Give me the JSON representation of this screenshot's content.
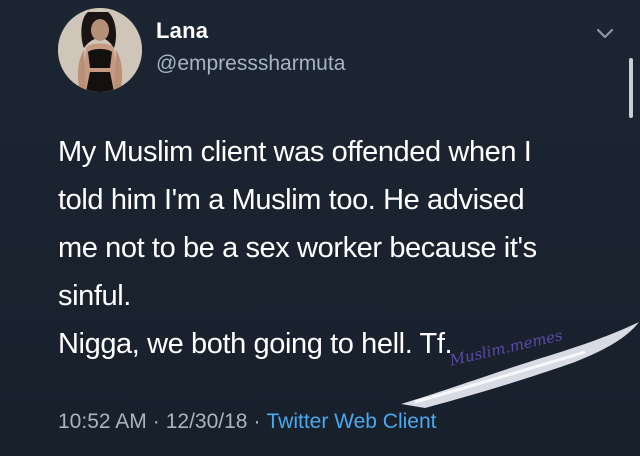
{
  "tweet": {
    "display_name": "Lana",
    "handle": "@empresssharmuta",
    "lines": [
      "My Muslim client was offended when I",
      "told him I'm a Muslim too. He advised",
      "me not to be a sex worker because it's",
      "sinful.",
      "Nigga, we both going to hell. Tf."
    ],
    "time": "10:52 AM",
    "date": "12/30/18",
    "separator": "·",
    "client": "Twitter Web Client"
  },
  "watermark": {
    "text": "Muslim.memes"
  },
  "icons": {
    "menu": "chevron-down-icon",
    "avatar": "profile-photo"
  },
  "colors": {
    "background": "#1b2431",
    "text": "#ffffff",
    "secondary": "#a7b4c2",
    "link": "#4aa8ec"
  }
}
